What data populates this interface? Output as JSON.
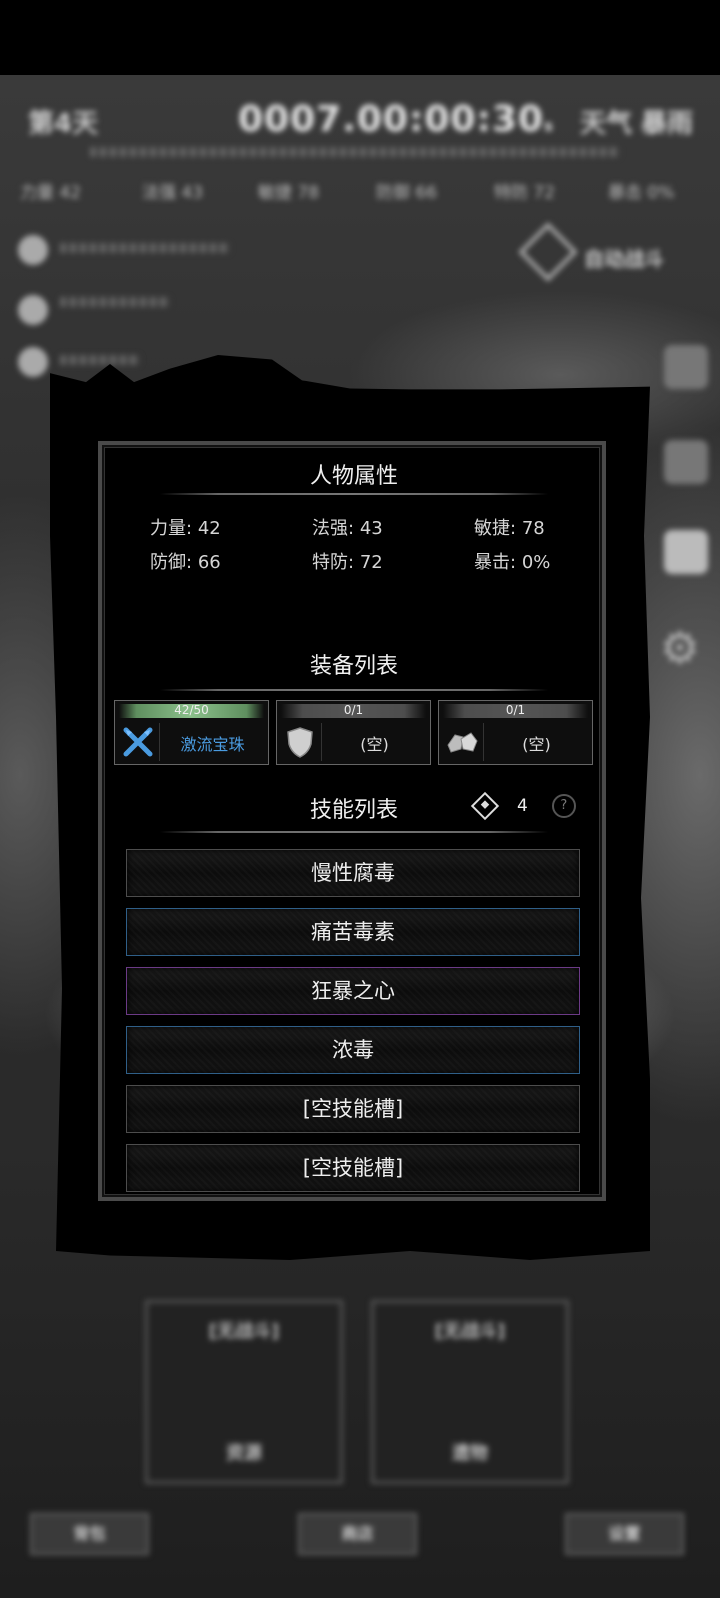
{
  "background": {
    "day_label": "第4天",
    "clock": "0007.00:00:30",
    "clock_unit": "s",
    "weather": "天气 暴雨",
    "stats": [
      "力量 42",
      "法强 43",
      "敏捷 78",
      "防御 66",
      "特防 72",
      "暴击 0%"
    ],
    "status_right": "自动战斗",
    "cards": [
      {
        "label": "[无战斗]",
        "name": "资源"
      },
      {
        "label": "[无战斗]",
        "name": "遗物"
      }
    ],
    "bottom_buttons": [
      "背包",
      "商店",
      "设置"
    ]
  },
  "panel": {
    "attributes_title": "人物属性",
    "attributes": [
      {
        "label": "力量:",
        "value": "42"
      },
      {
        "label": "法强:",
        "value": "43"
      },
      {
        "label": "敏捷:",
        "value": "78"
      },
      {
        "label": "防御:",
        "value": "66"
      },
      {
        "label": "特防:",
        "value": "72"
      },
      {
        "label": "暴击:",
        "value": "0%"
      }
    ],
    "equipment_title": "装备列表",
    "equipment": [
      {
        "count": "42/50",
        "name": "激流宝珠",
        "icon": "crossed-swords-icon",
        "color": "#4a9be0"
      },
      {
        "count": "0/1",
        "name": "(空)",
        "icon": "shield-icon"
      },
      {
        "count": "0/1",
        "name": "(空)",
        "icon": "stones-icon"
      }
    ],
    "skills_title": "技能列表",
    "skill_points": "4",
    "help_symbol": "?",
    "skills": [
      {
        "name": "慢性腐毒",
        "rarity": "common"
      },
      {
        "name": "痛苦毒素",
        "rarity": "rare"
      },
      {
        "name": "狂暴之心",
        "rarity": "epic"
      },
      {
        "name": "浓毒",
        "rarity": "rare"
      },
      {
        "name": "[空技能槽]",
        "rarity": "empty"
      },
      {
        "name": "[空技能槽]",
        "rarity": "empty"
      }
    ]
  }
}
